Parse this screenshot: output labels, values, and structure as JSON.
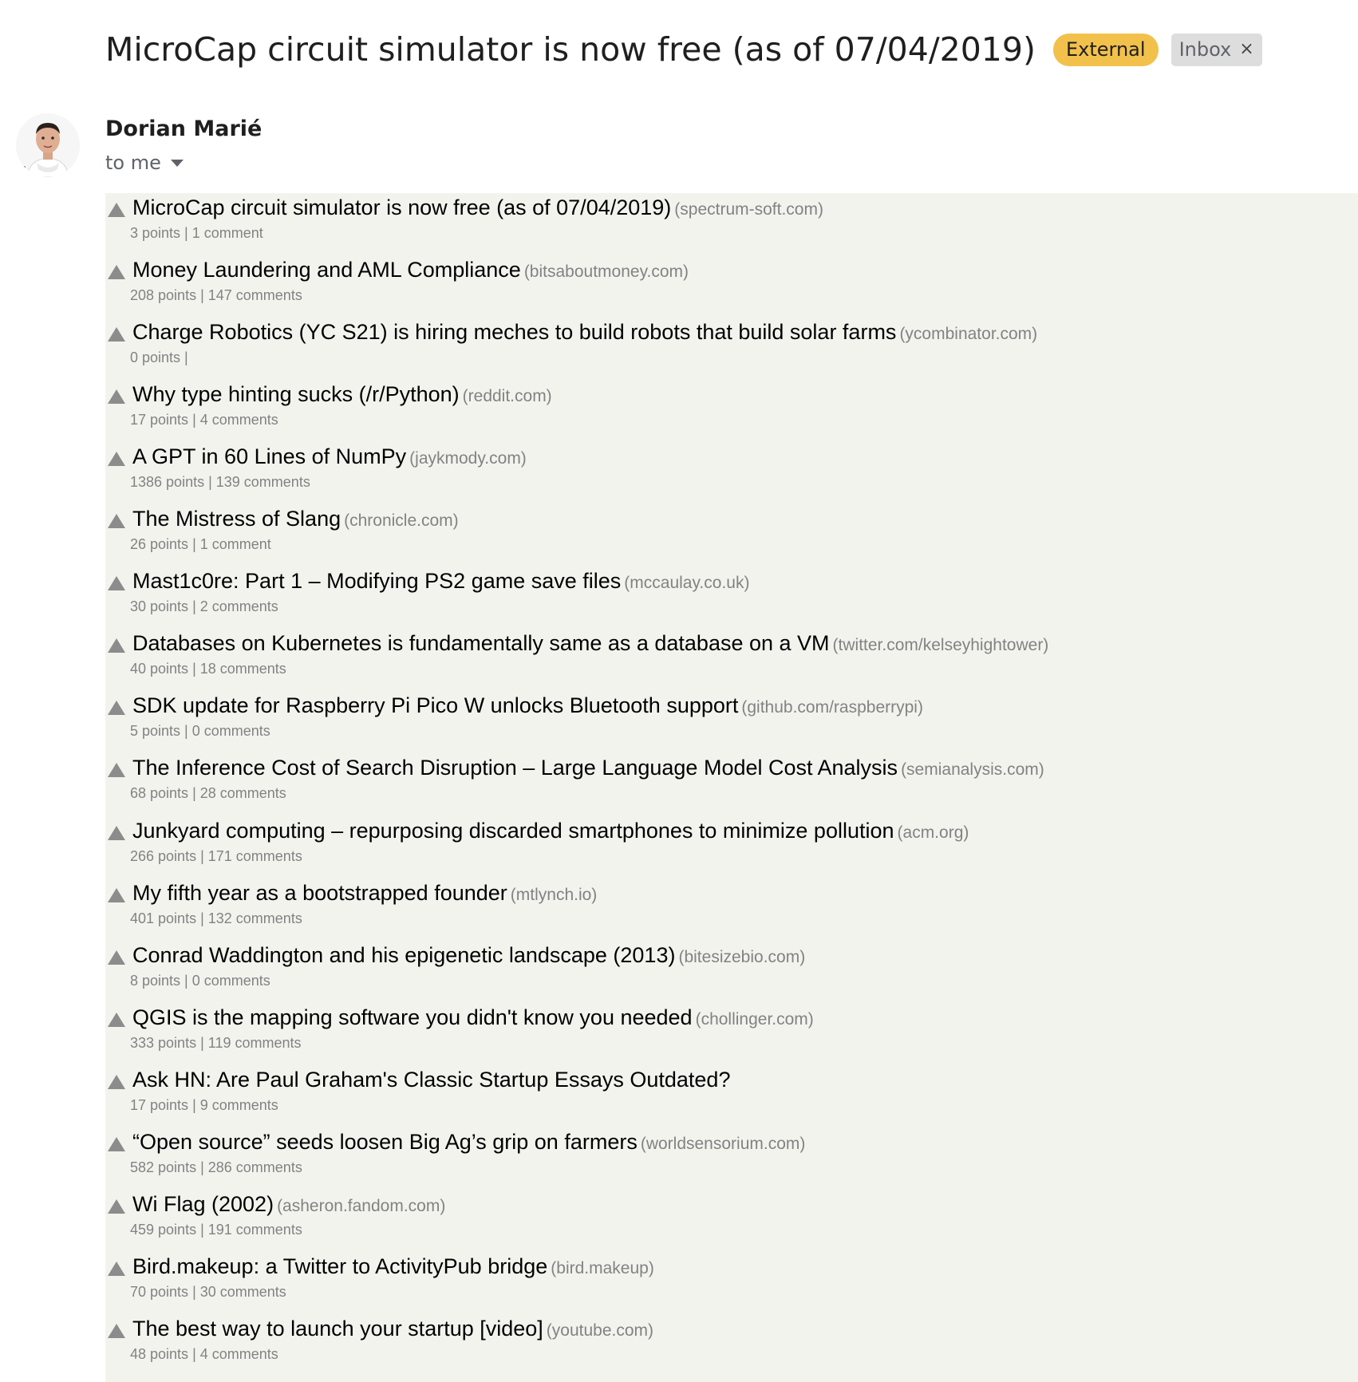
{
  "email": {
    "subject": "MicroCap circuit simulator is now free (as of 07/04/2019)",
    "labels": {
      "external": "External",
      "inbox": "Inbox",
      "inbox_remove": "×"
    },
    "sender": {
      "name": "Dorian Marié",
      "recipient": "to me"
    }
  },
  "colors": {
    "external_badge": "#f2c14c",
    "inbox_badge": "#dddddd",
    "digest_background": "#f3f3ee",
    "meta_text": "#828282"
  },
  "stories": [
    {
      "title": "MicroCap circuit simulator is now free (as of 07/04/2019)",
      "domain": "(spectrum-soft.com)",
      "points": "3 points",
      "comments": "1 comment"
    },
    {
      "title": "Money Laundering and AML Compliance",
      "domain": "(bitsaboutmoney.com)",
      "points": "208 points",
      "comments": "147 comments"
    },
    {
      "title": "Charge Robotics (YC S21) is hiring meches to build robots that build solar farms",
      "domain": "(ycombinator.com)",
      "points": "0 points",
      "comments": ""
    },
    {
      "title": "Why type hinting sucks (/r/Python)",
      "domain": "(reddit.com)",
      "points": "17 points",
      "comments": "4 comments"
    },
    {
      "title": "A GPT in 60 Lines of NumPy",
      "domain": "(jaykmody.com)",
      "points": "1386 points",
      "comments": "139 comments"
    },
    {
      "title": "The Mistress of Slang",
      "domain": "(chronicle.com)",
      "points": "26 points",
      "comments": "1 comment"
    },
    {
      "title": "Mast1c0re: Part 1 – Modifying PS2 game save files",
      "domain": "(mccaulay.co.uk)",
      "points": "30 points",
      "comments": "2 comments"
    },
    {
      "title": "Databases on Kubernetes is fundamentally same as a database on a VM",
      "domain": "(twitter.com/kelseyhightower)",
      "points": "40 points",
      "comments": "18 comments"
    },
    {
      "title": "SDK update for Raspberry Pi Pico W unlocks Bluetooth support",
      "domain": "(github.com/raspberrypi)",
      "points": "5 points",
      "comments": "0 comments"
    },
    {
      "title": "The Inference Cost of Search Disruption – Large Language Model Cost Analysis",
      "domain": "(semianalysis.com)",
      "points": "68 points",
      "comments": "28 comments"
    },
    {
      "title": "Junkyard computing – repurposing discarded smartphones to minimize pollution",
      "domain": "(acm.org)",
      "points": "266 points",
      "comments": "171 comments"
    },
    {
      "title": "My fifth year as a bootstrapped founder",
      "domain": "(mtlynch.io)",
      "points": "401 points",
      "comments": "132 comments"
    },
    {
      "title": "Conrad Waddington and his epigenetic landscape (2013)",
      "domain": "(bitesizebio.com)",
      "points": "8 points",
      "comments": "0 comments"
    },
    {
      "title": "QGIS is the mapping software you didn't know you needed",
      "domain": "(chollinger.com)",
      "points": "333 points",
      "comments": "119 comments"
    },
    {
      "title": "Ask HN: Are Paul Graham's Classic Startup Essays Outdated?",
      "domain": "",
      "points": "17 points",
      "comments": "9 comments"
    },
    {
      "title": "“Open source” seeds loosen Big Ag’s grip on farmers",
      "domain": "(worldsensorium.com)",
      "points": "582 points",
      "comments": "286 comments"
    },
    {
      "title": "Wi Flag (2002)",
      "domain": "(asheron.fandom.com)",
      "points": "459 points",
      "comments": "191 comments"
    },
    {
      "title": "Bird.makeup: a Twitter to ActivityPub bridge",
      "domain": "(bird.makeup)",
      "points": "70 points",
      "comments": "30 comments"
    },
    {
      "title": "The best way to launch your startup [video]",
      "domain": "(youtube.com)",
      "points": "48 points",
      "comments": "4 comments"
    }
  ],
  "meta_separator": "|"
}
